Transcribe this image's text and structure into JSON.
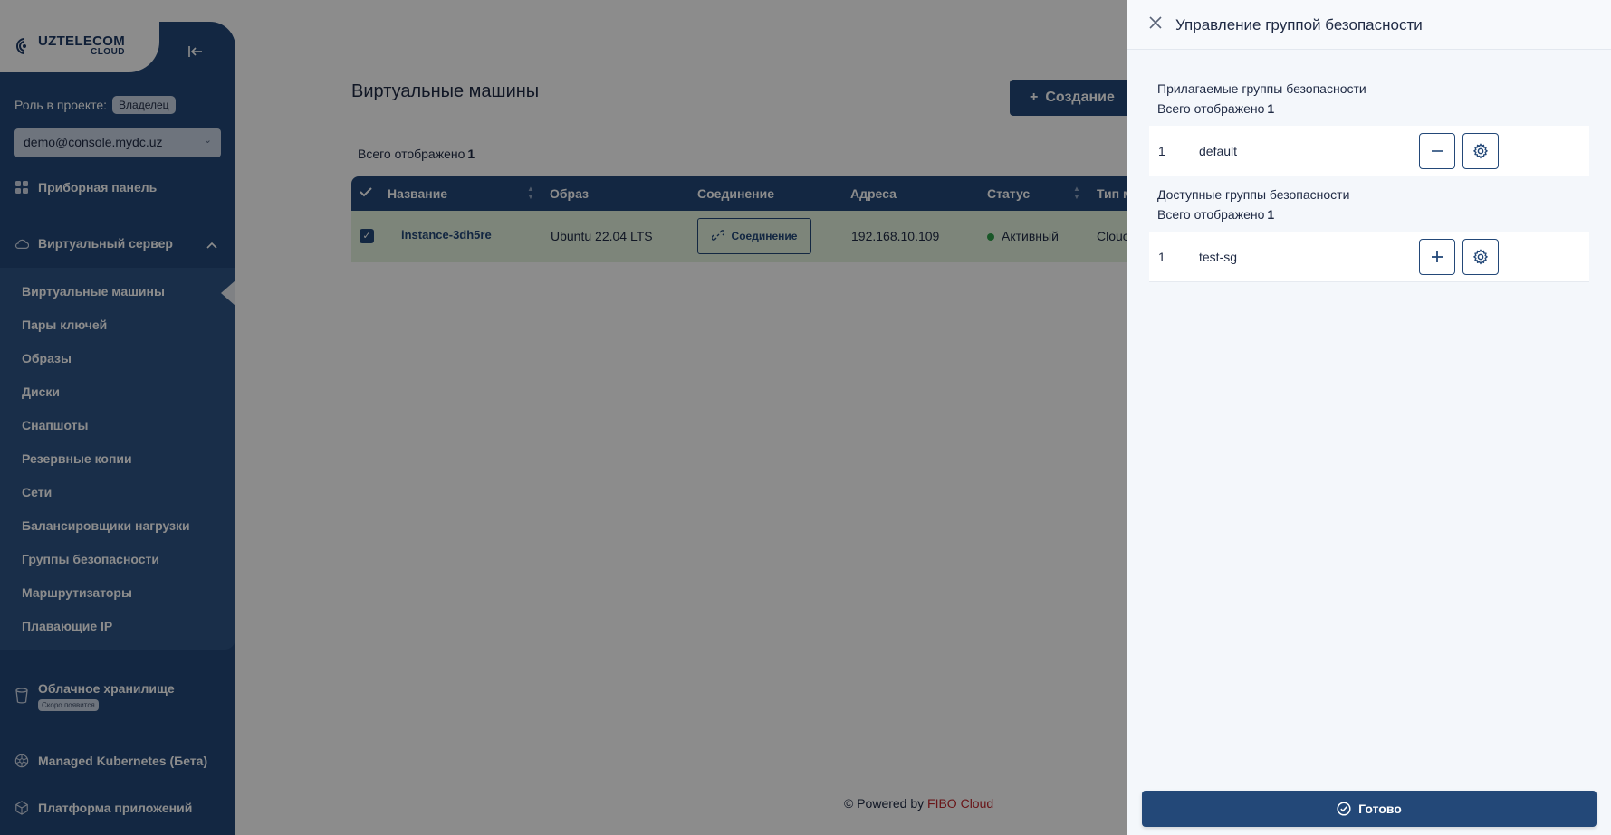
{
  "colors": {
    "primary": "#234878",
    "sidebar_sub": "#2e5486",
    "selected_row": "#e4f3df",
    "status_active": "#2e9e49",
    "brand_red": "#c0272d"
  },
  "sidebar": {
    "logo_line1": "UZTELECOM",
    "logo_line2": "CLOUD",
    "role_label": "Роль в проекте:",
    "role_value": "Владелец",
    "account": "demo@console.mydc.uz",
    "dashboard": "Приборная панель",
    "virtual_server": "Виртуальный сервер",
    "sub_items": [
      "Виртуальные машины",
      "Пары ключей",
      "Образы",
      "Диски",
      "Снапшоты",
      "Резервные копии",
      "Сети",
      "Балансировщики нагрузки",
      "Группы безопасности",
      "Маршрутизаторы",
      "Плавающие IP"
    ],
    "storage": "Облачное хранилище",
    "storage_badge": "Скоро появится",
    "kubernetes": "Managed Kubernetes (Бета)",
    "app_platform": "Платформа приложений"
  },
  "main": {
    "title": "Виртуальные машины",
    "create_button": "Создание",
    "total_label": "Всего отображено",
    "total_count": "1",
    "columns": [
      "Название",
      "Образ",
      "Соединение",
      "Адреса",
      "Статус",
      "Тип м"
    ],
    "row": {
      "name": "instance-3dh5re",
      "image": "Ubuntu 22.04 LTS",
      "connect": "Соединение",
      "address": "192.168.10.109",
      "status": "Активный",
      "type": "Clouc"
    }
  },
  "footer": {
    "prefix": "© Powered by",
    "brand": "FIBO Cloud"
  },
  "drawer": {
    "title": "Управление группой безопасности",
    "attached_title": "Прилагаемые группы безопасности",
    "attached_total_label": "Всего отображено",
    "attached_total": "1",
    "attached": [
      {
        "num": "1",
        "name": "default"
      }
    ],
    "available_title": "Доступные группы безопасности",
    "available_total_label": "Всего отображено",
    "available_total": "1",
    "available": [
      {
        "num": "1",
        "name": "test-sg"
      }
    ],
    "done_button": "Готово"
  }
}
